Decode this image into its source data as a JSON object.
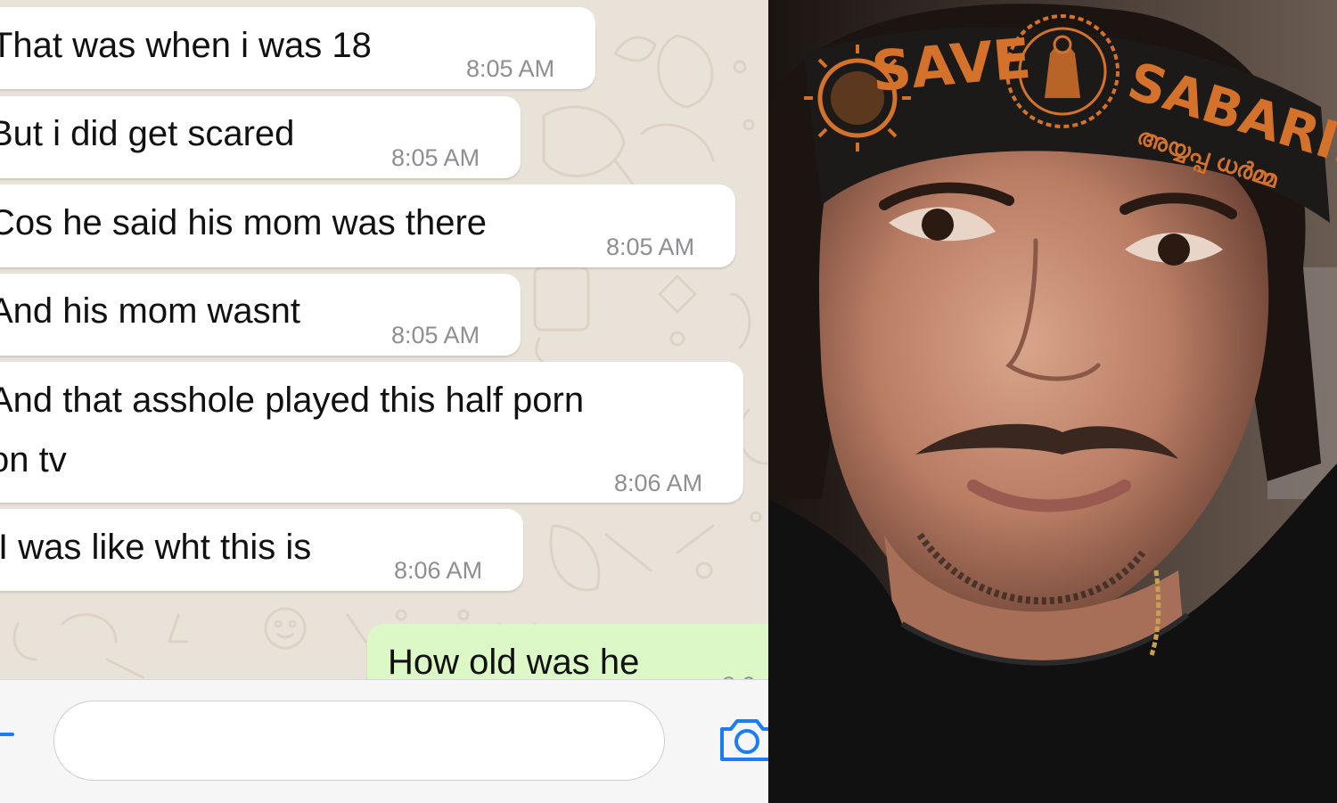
{
  "chat": {
    "messages": [
      {
        "text": "That was when i was 18",
        "time": "8:05 AM",
        "direction": "incoming"
      },
      {
        "text": "But i did get scared",
        "time": "8:05 AM",
        "direction": "incoming"
      },
      {
        "text": "Cos he said his mom was there",
        "time": "8:05 AM",
        "direction": "incoming"
      },
      {
        "text": "And his mom wasnt",
        "time": "8:05 AM",
        "direction": "incoming"
      },
      {
        "text_line1": "And that asshole played this half porn",
        "text_line2": "on tv",
        "time": "8:06 AM",
        "direction": "incoming"
      },
      {
        "text": "I was like wht this is",
        "time": "8:06 AM",
        "direction": "incoming"
      },
      {
        "text": "How old was he",
        "time": "8:0",
        "direction": "outgoing"
      }
    ],
    "composer": {
      "input_value": "",
      "icons": [
        "plus-icon",
        "camera-icon"
      ]
    },
    "colors": {
      "wallpaper": "#e9e2d8",
      "incoming_bubble": "#ffffff",
      "outgoing_bubble": "#dcf8c6",
      "accent": "#1a7cf6",
      "timestamp": "#8e8e93"
    }
  },
  "photo": {
    "headband": {
      "text_left": "SAVE",
      "text_right": "SABARIMALA",
      "text_malayalam": "അയ്യപ്പ ധർമ്മ",
      "color": "#d4722c",
      "band_color": "#1c1a18"
    }
  }
}
